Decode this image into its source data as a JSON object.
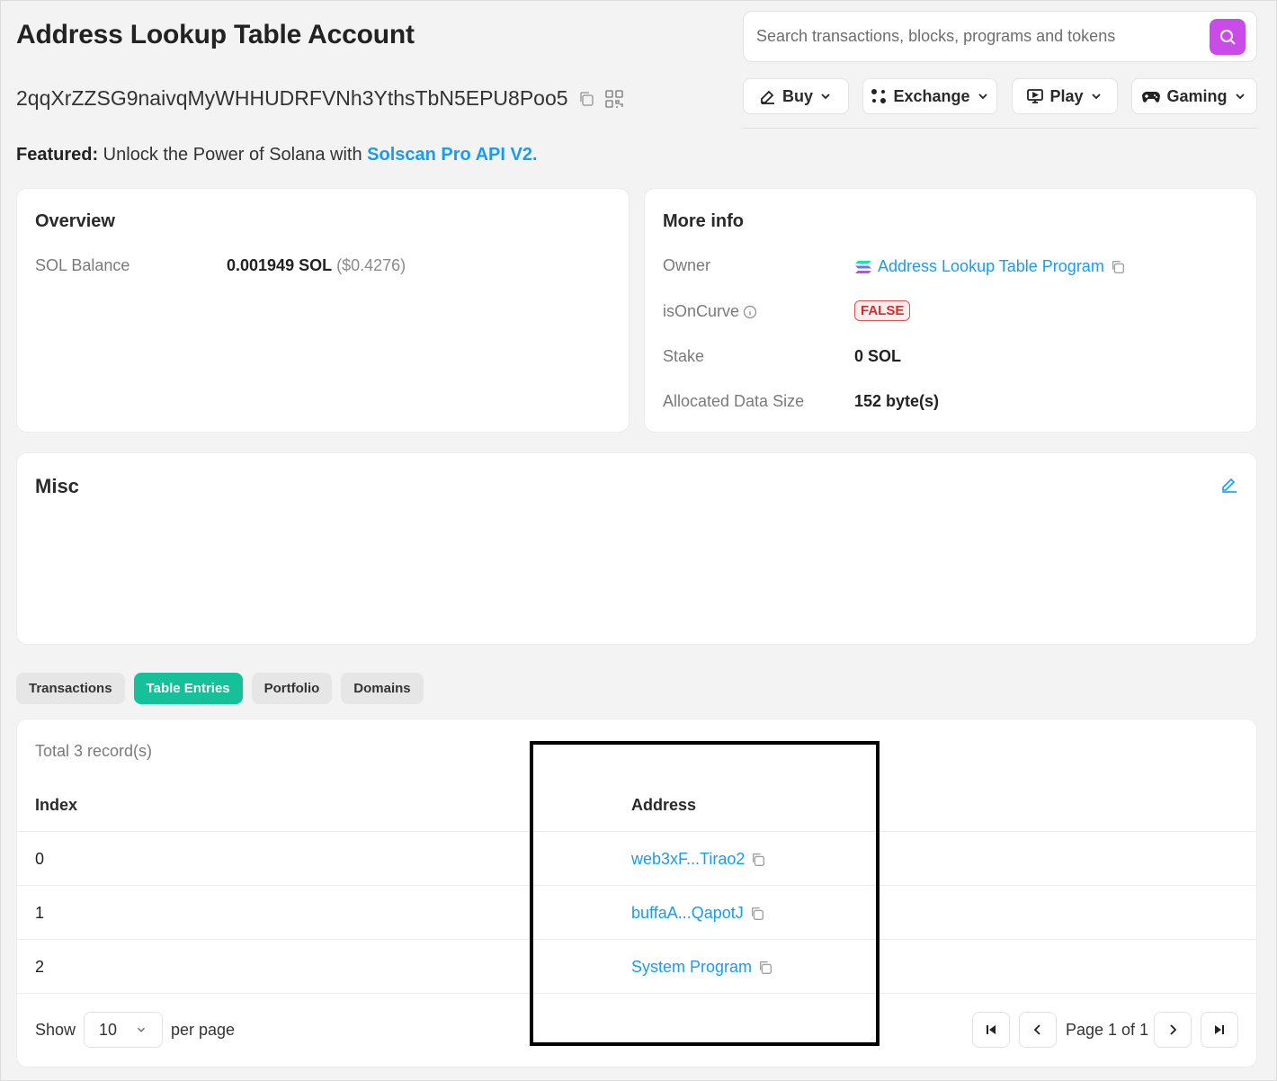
{
  "header": {
    "title": "Address Lookup Table Account",
    "address": "2qqXrZZSG9naivqMyWHHUDRFVNh3YthsTbN5EPU8Poo5"
  },
  "search": {
    "placeholder": "Search transactions, blocks, programs and tokens"
  },
  "nav_menus": [
    {
      "label": "Buy",
      "icon": "buy-icon"
    },
    {
      "label": "Exchange",
      "icon": "exchange-icon"
    },
    {
      "label": "Play",
      "icon": "play-icon"
    },
    {
      "label": "Gaming",
      "icon": "gamepad-icon"
    }
  ],
  "featured": {
    "prefix": "Featured:",
    "text": " Unlock the Power of Solana with ",
    "link": "Solscan Pro API V2."
  },
  "overview": {
    "title": "Overview",
    "sol_balance_label": "SOL Balance",
    "sol_balance_value": "0.001949 SOL",
    "sol_balance_usd": "($0.4276)"
  },
  "more_info": {
    "title": "More info",
    "owner_label": "Owner",
    "owner_value": "Address Lookup Table Program",
    "is_on_curve_label": "isOnCurve",
    "is_on_curve_value": "FALSE",
    "stake_label": "Stake",
    "stake_value": "0 SOL",
    "data_size_label": "Allocated Data Size",
    "data_size_value": "152 byte(s)"
  },
  "misc": {
    "title": "Misc"
  },
  "tabs": [
    {
      "label": "Transactions",
      "active": false
    },
    {
      "label": "Table Entries",
      "active": true
    },
    {
      "label": "Portfolio",
      "active": false
    },
    {
      "label": "Domains",
      "active": false
    }
  ],
  "table": {
    "total": "Total 3 record(s)",
    "columns": [
      "Index",
      "Address"
    ],
    "rows": [
      {
        "index": "0",
        "address": "web3xF...Tirao2"
      },
      {
        "index": "1",
        "address": "buffaA...QapotJ"
      },
      {
        "index": "2",
        "address": "System Program"
      }
    ]
  },
  "pagination": {
    "show_label": "Show",
    "page_size": "10",
    "per_page_label": "per page",
    "page_text": "Page 1 of 1"
  },
  "colors": {
    "accent_link": "#1a9bf0",
    "active_tab": "#16c098",
    "search_button": "#c94be8",
    "false_badge": "#c9302c"
  }
}
